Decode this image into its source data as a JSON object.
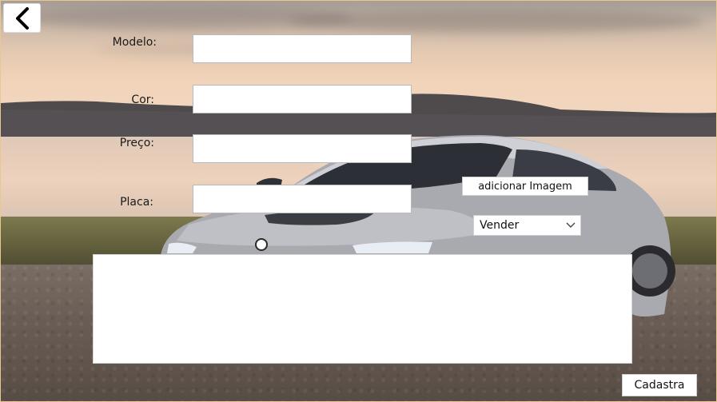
{
  "nav": {
    "back_icon": "chevron-left-icon"
  },
  "form": {
    "modelo_label": "Modelo:",
    "cor_label": "Cor:",
    "preco_label": "Preço:",
    "placa_label": "Placa:",
    "modelo_value": "",
    "cor_value": "",
    "preco_value": "",
    "placa_value": ""
  },
  "actions": {
    "add_image_label": "adicionar Imagem",
    "submit_label": "Cadastra"
  },
  "dropdown": {
    "selected": "Vender",
    "icon": "chevron-down-icon"
  },
  "description": {
    "value": ""
  },
  "colors": {
    "window_border": "#e9c88f",
    "field_bg": "#ffffff",
    "field_border": "#b9b9b9"
  }
}
